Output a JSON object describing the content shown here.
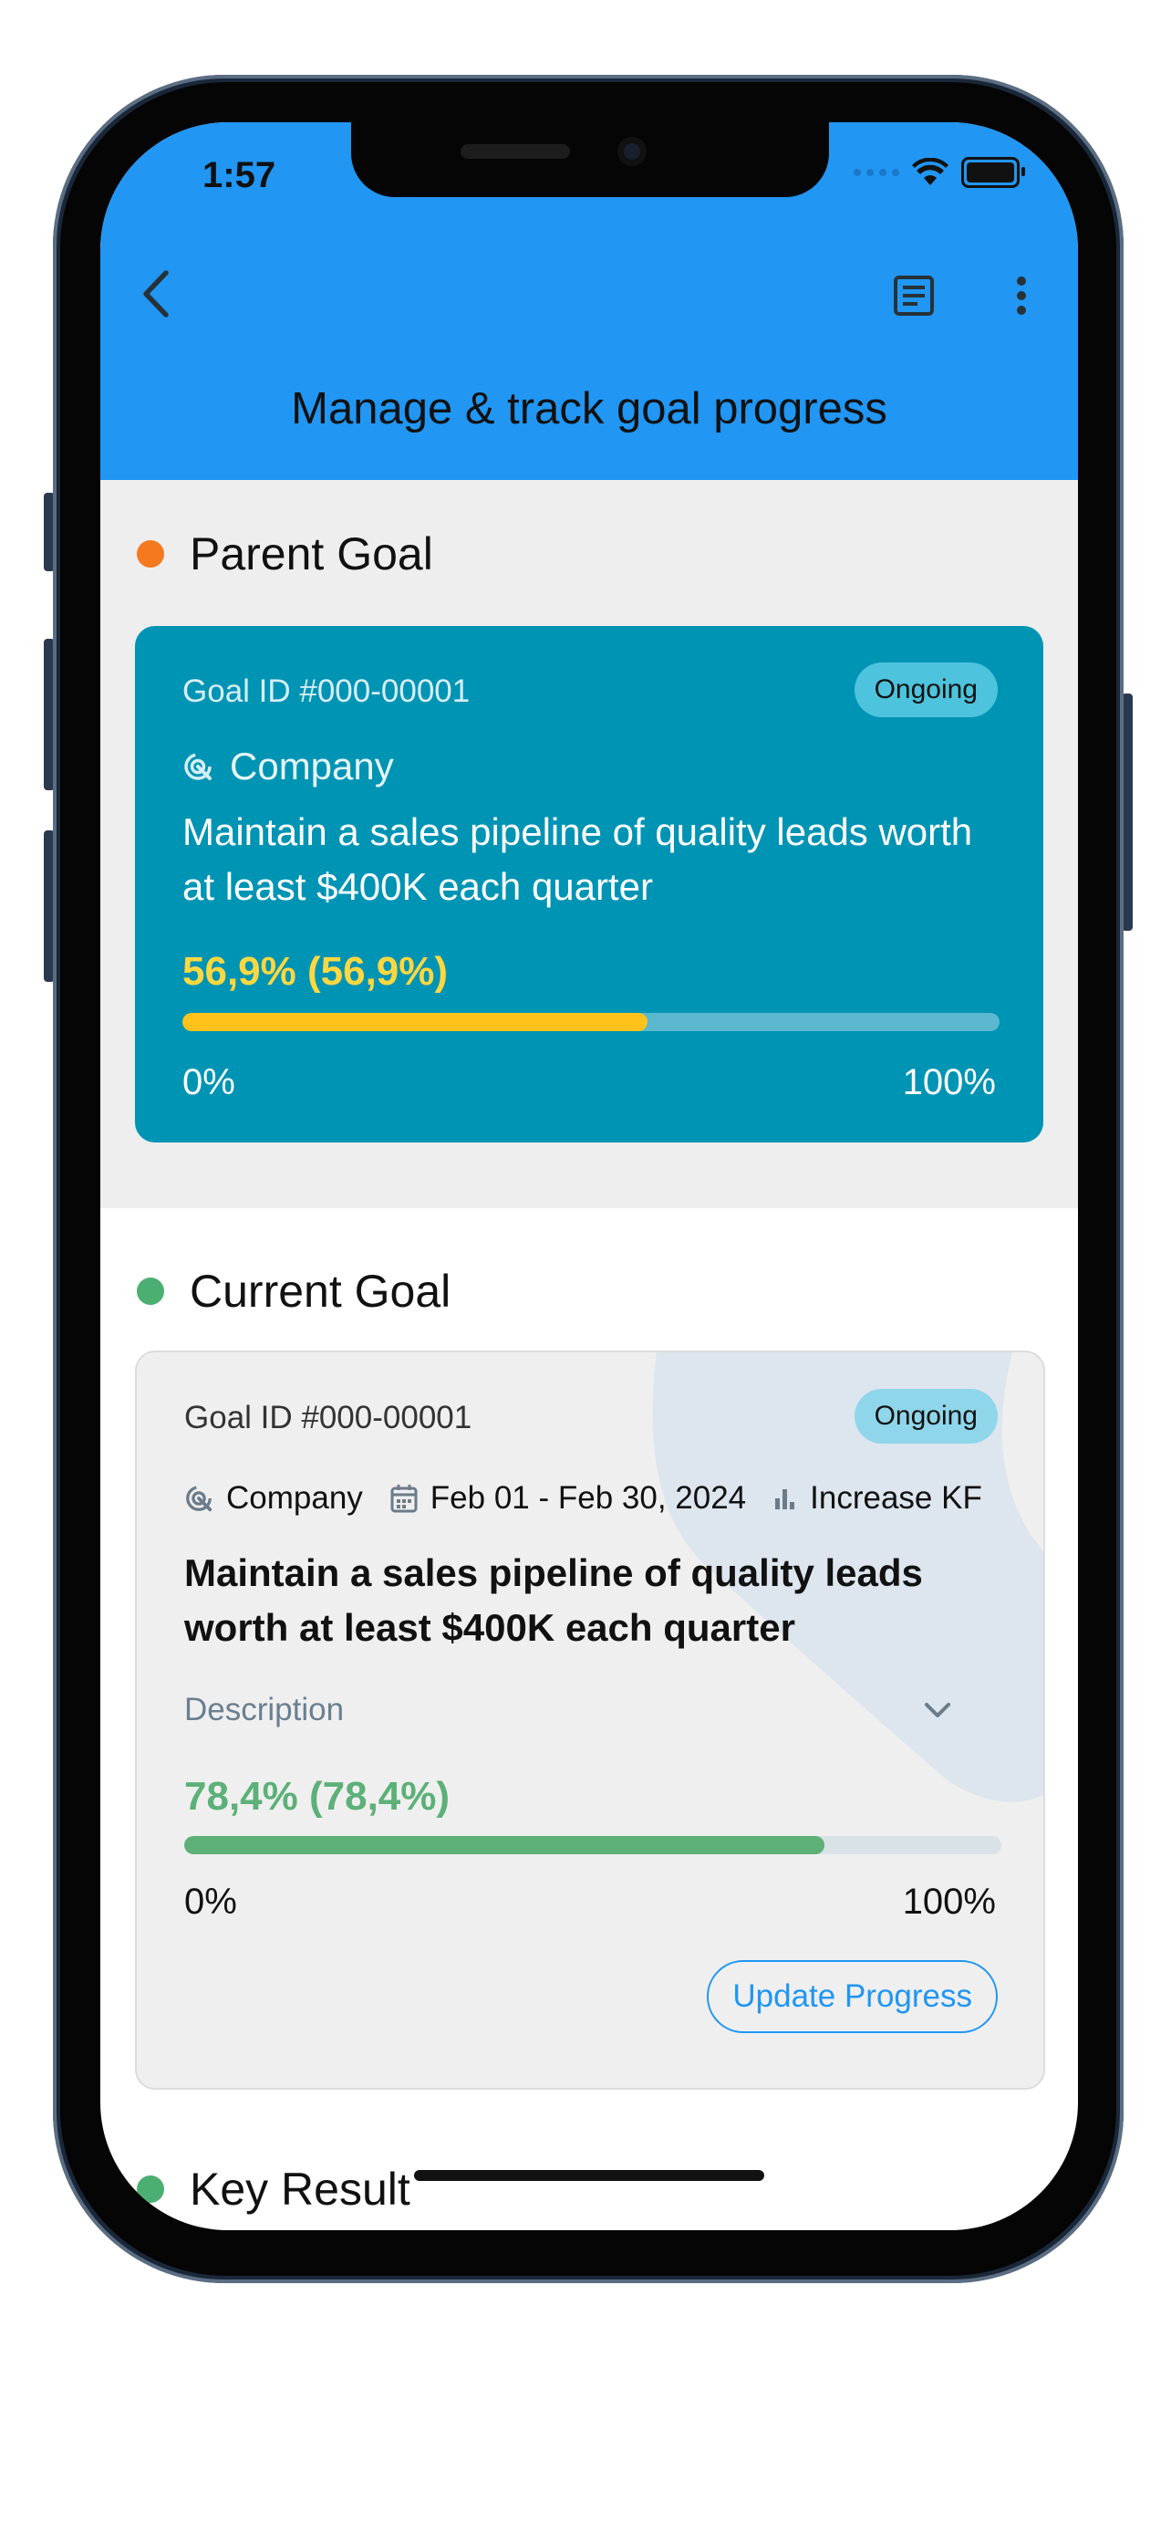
{
  "status_bar": {
    "time": "1:57"
  },
  "header": {
    "title": "Manage & track goal progress"
  },
  "parent_goal": {
    "section_title": "Parent Goal",
    "goal_id": "Goal ID #000-00001",
    "status": "Ongoing",
    "category": "Company",
    "text": "Maintain a sales pipeline of quality leads worth at least $400K each quarter",
    "progress_label": "56,9% (56,9%)",
    "progress_fraction": 0.569,
    "scale_min": "0%",
    "scale_max": "100%"
  },
  "current_goal": {
    "section_title": "Current Goal",
    "goal_id": "Goal ID #000-00001",
    "status": "Ongoing",
    "category": "Company",
    "date_range": "Feb 01 - Feb 30, 2024",
    "metric": "Increase KF",
    "text": "Maintain a sales pipeline of quality leads worth at least $400K each quarter",
    "description_label": "Description",
    "progress_label": "78,4% (78,4%)",
    "progress_fraction": 0.784,
    "scale_min": "0%",
    "scale_max": "100%",
    "update_button": "Update Progress"
  },
  "key_result": {
    "section_title": "Key Result"
  },
  "colors": {
    "app_bar": "#2196f3",
    "parent_card": "#0094b4",
    "parent_dot": "#f4791f",
    "current_dot": "#4caf72",
    "parent_progress": "#ffc21a",
    "current_progress": "#5cb078",
    "accent": "#2196f3"
  }
}
